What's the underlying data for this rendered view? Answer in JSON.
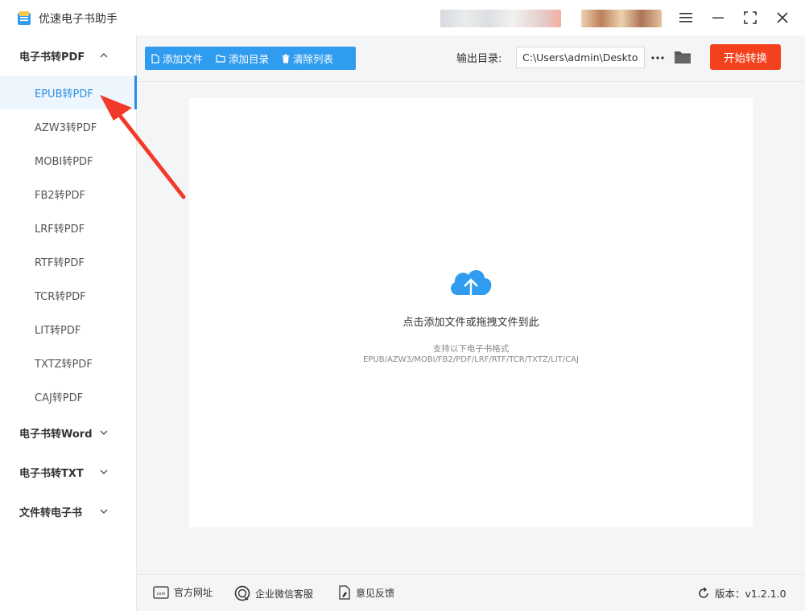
{
  "app": {
    "title": "优速电子书助手"
  },
  "window_controls": {
    "menu_icon": "hamburger-icon",
    "minimize_icon": "minimize-icon",
    "maximize_icon": "maximize-icon",
    "close_icon": "close-icon"
  },
  "sidebar": {
    "groups": [
      {
        "label": "电子书转PDF",
        "expanded": true,
        "items": [
          {
            "label": "EPUB转PDF",
            "active": true
          },
          {
            "label": "AZW3转PDF",
            "active": false
          },
          {
            "label": "MOBI转PDF",
            "active": false
          },
          {
            "label": "FB2转PDF",
            "active": false
          },
          {
            "label": "LRF转PDF",
            "active": false
          },
          {
            "label": "RTF转PDF",
            "active": false
          },
          {
            "label": "TCR转PDF",
            "active": false
          },
          {
            "label": "LIT转PDF",
            "active": false
          },
          {
            "label": "TXTZ转PDF",
            "active": false
          },
          {
            "label": "CAJ转PDF",
            "active": false
          }
        ]
      },
      {
        "label": "电子书转Word",
        "expanded": false
      },
      {
        "label": "电子书转TXT",
        "expanded": false
      },
      {
        "label": "文件转电子书",
        "expanded": false
      }
    ]
  },
  "toolbar": {
    "add_file": "添加文件",
    "add_folder": "添加目录",
    "clear_list": "清除列表",
    "output_label": "输出目录:",
    "output_path": "C:\\Users\\admin\\Deskto",
    "more_icon": "ellipsis-icon",
    "folder_icon": "folder-icon",
    "start_button": "开始转换"
  },
  "drop_zone": {
    "icon": "cloud-upload-icon",
    "title": "点击添加文件或拖拽文件到此",
    "supported_label": "支持以下电子书格式",
    "supported_formats": "EPUB/AZW3/MOBI/FB2/PDF/LRF/RTF/TCR/TXTZ/LIT/CAJ"
  },
  "footer": {
    "website": "官方网址",
    "wechat_support": "企业微信客服",
    "feedback": "意见反馈",
    "version": "版本：v1.2.1.0"
  },
  "colors": {
    "accent_blue": "#2f9cf0",
    "start_red": "#f4421e",
    "active_text": "#2b8fe8",
    "annotation_red": "#f23a2a"
  }
}
